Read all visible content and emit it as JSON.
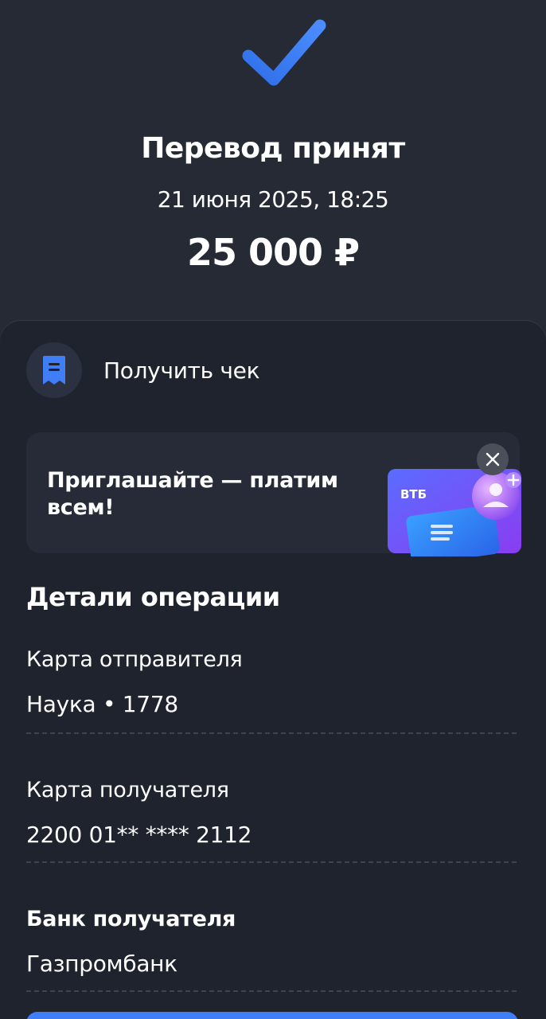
{
  "header": {
    "status_title": "Перевод принят",
    "datetime": "21 июня 2025, 18:25",
    "amount": "25 000 ₽",
    "status_icon": "checkmark-icon",
    "accent_color": "#3f7ef6"
  },
  "receipt": {
    "label": "Получить чек",
    "icon": "receipt-icon"
  },
  "promo": {
    "text": "Приглашайте — платим всем!",
    "bank_logo": "ВТБ",
    "close_icon": "close-icon"
  },
  "details": {
    "title": "Детали операции",
    "items": [
      {
        "label": "Карта отправителя",
        "value": "Наука • 1778"
      },
      {
        "label": "Карта получателя",
        "value": "2200 01** **** 2112"
      },
      {
        "label": "Банк получателя",
        "value": "Газпромбанк"
      }
    ]
  }
}
